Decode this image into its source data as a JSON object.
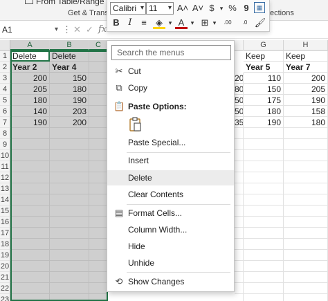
{
  "ribbon": {
    "from_table_label": "From Table/Range",
    "get_transform_label": "Get & Transfo",
    "selection_label": "ections"
  },
  "mini_toolbar": {
    "font_name": "Calibri",
    "font_size": "11",
    "grow_font": "A˄",
    "shrink_font": "A˅",
    "currency": "$",
    "percent": "%",
    "comma": "9",
    "bold": "B",
    "italic": "I",
    "increase_decimal": ".00",
    "decrease_decimal": ".0"
  },
  "name_box": {
    "value": "A1"
  },
  "fx_label": "fx",
  "columns": [
    {
      "letter": "A",
      "selected": true
    },
    {
      "letter": "B",
      "selected": true
    },
    {
      "letter": "C",
      "selected": true
    },
    {
      "letter": "D",
      "selected": false
    },
    {
      "letter": "E",
      "selected": false
    },
    {
      "letter": "F",
      "selected": false
    },
    {
      "letter": "G",
      "selected": false
    },
    {
      "letter": "H",
      "selected": false
    }
  ],
  "rows": [
    "1",
    "2",
    "3",
    "4",
    "5",
    "6",
    "7",
    "8",
    "9",
    "10",
    "11",
    "12",
    "13",
    "14",
    "15",
    "16",
    "17",
    "18",
    "19",
    "20",
    "21",
    "22",
    "23"
  ],
  "sheet": {
    "left": {
      "row1": [
        "Delete",
        "Delete",
        ""
      ],
      "row2": [
        "Year 2",
        "Year 4",
        ""
      ],
      "data": [
        [
          "200",
          "150"
        ],
        [
          "205",
          "180"
        ],
        [
          "180",
          "190"
        ],
        [
          "140",
          "203"
        ],
        [
          "190",
          "200"
        ]
      ]
    },
    "right": {
      "row1": [
        "",
        "Keep",
        "Keep"
      ],
      "row2": [
        "",
        "Year 5",
        "Year 7"
      ],
      "data": [
        [
          "20",
          "110",
          "200"
        ],
        [
          "80",
          "150",
          "205"
        ],
        [
          "50",
          "175",
          "190"
        ],
        [
          "50",
          "180",
          "158"
        ],
        [
          "35",
          "190",
          "180"
        ]
      ]
    }
  },
  "context_menu": {
    "search_placeholder": "Search the menus",
    "items": {
      "cut": "Cut",
      "copy": "Copy",
      "paste_options": "Paste Options:",
      "paste_special": "Paste Special...",
      "insert": "Insert",
      "delete": "Delete",
      "clear_contents": "Clear Contents",
      "format_cells": "Format Cells...",
      "column_width": "Column Width...",
      "hide": "Hide",
      "unhide": "Unhide",
      "show_changes": "Show Changes"
    }
  },
  "colors": {
    "selection_green": "#217346",
    "selected_fill": "#cfcfcf",
    "font_color_red": "#c00000",
    "highlight_yellow": "#ffd400"
  }
}
